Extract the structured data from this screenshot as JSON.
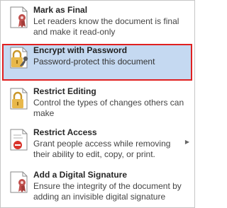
{
  "menu": {
    "items": [
      {
        "title": "Mark as Final",
        "description": "Let readers know the document is final and make it read-only",
        "icon": "ribbon-award-icon"
      },
      {
        "title": "Encrypt with Password",
        "description": "Password-protect this document",
        "icon": "lock-key-icon",
        "selected": true
      },
      {
        "title": "Restrict Editing",
        "description": "Control the types of changes others can make",
        "icon": "lock-document-icon"
      },
      {
        "title": "Restrict Access",
        "description": "Grant people access while removing their ability to edit, copy, or print.",
        "icon": "restricted-document-icon",
        "has_submenu": true
      },
      {
        "title": "Add a Digital Signature",
        "description": "Ensure the integrity of the document by adding an invisible digital signature",
        "icon": "signature-ribbon-icon"
      }
    ]
  },
  "colors": {
    "selected_bg": "#c5d9f1",
    "selected_border": "#e02020",
    "ribbon": "#c0504d",
    "lock": "#e8b84b"
  }
}
